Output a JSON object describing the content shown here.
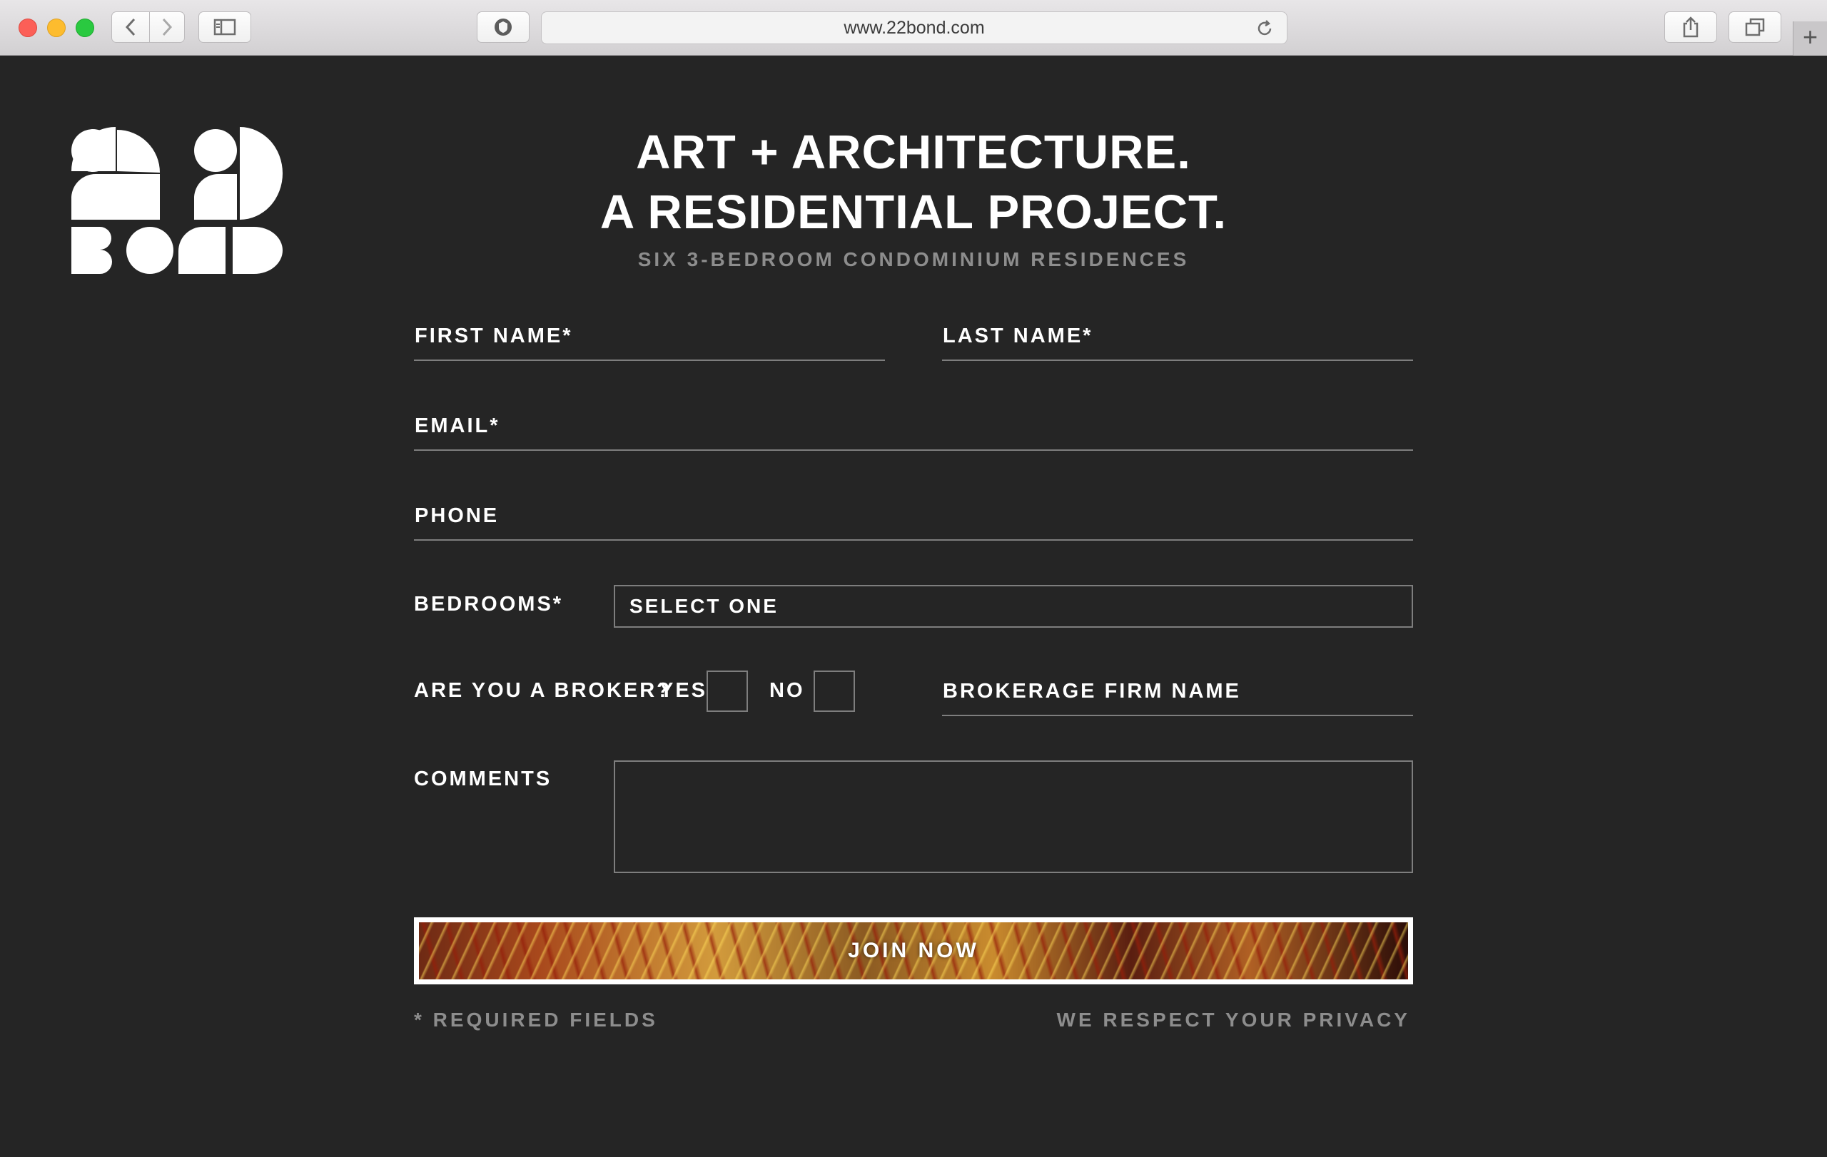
{
  "browser": {
    "url": "www.22bond.com"
  },
  "brand": {
    "logo_text": "22 BOND"
  },
  "hero": {
    "line1": "ART + ARCHITECTURE.",
    "line2": "A RESIDENTIAL PROJECT.",
    "subtitle": "SIX 3-BEDROOM CONDOMINIUM RESIDENCES"
  },
  "form": {
    "first_name_label": "FIRST NAME*",
    "last_name_label": "LAST NAME*",
    "email_label": "EMAIL*",
    "phone_label": "PHONE",
    "bedrooms_label": "BEDROOMS*",
    "bedrooms_selected": "SELECT ONE",
    "broker_question": "ARE YOU A BROKER?",
    "broker_yes": "YES",
    "broker_no": "NO",
    "brokerage_label": "BROKERAGE FIRM NAME",
    "comments_label": "COMMENTS",
    "submit_label": "JOIN NOW",
    "required_note": "* REQUIRED FIELDS",
    "privacy_note": "WE RESPECT YOUR PRIVACY"
  },
  "icons": {
    "back": "chevron-left-icon",
    "forward": "chevron-right-icon",
    "sidebar": "sidebar-icon",
    "privacy": "shield-icon",
    "reload": "reload-icon",
    "share": "share-icon",
    "tabs": "tabs-icon",
    "new_tab": "plus-icon"
  },
  "colors": {
    "page_bg": "#252525",
    "text": "#ffffff",
    "muted_text": "#8d8d8d",
    "rule": "#7e7e7e"
  }
}
